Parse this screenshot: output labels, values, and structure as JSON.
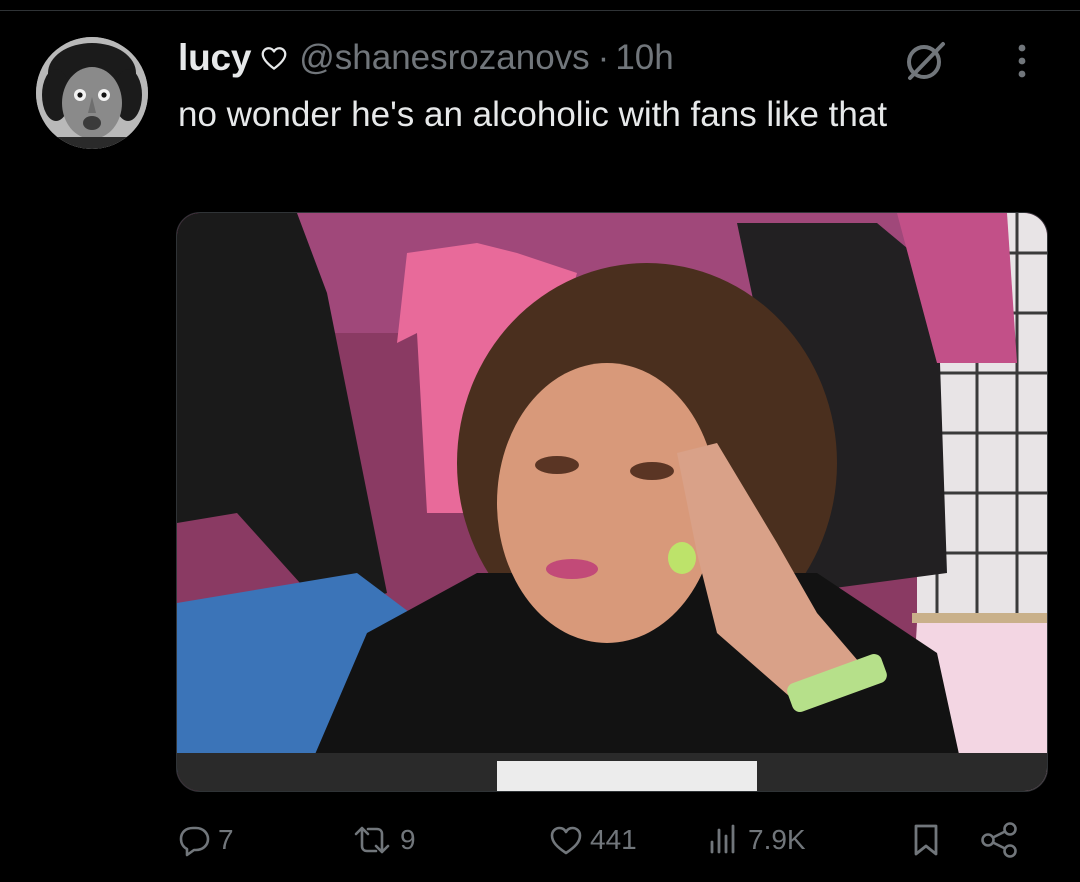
{
  "post": {
    "display_name": "lucy",
    "handle": "@shanesrozanovs",
    "separator": "·",
    "timestamp": "10h",
    "text": "no wonder he's an alcoholic with fans like that"
  },
  "icons": {
    "name_badge": "heart-outline-icon",
    "grok": "grok-icon",
    "more": "more-vertical-icon",
    "reply": "reply-icon",
    "retweet": "retweet-icon",
    "like": "heart-icon",
    "views": "views-bar-chart-icon",
    "bookmark": "bookmark-icon",
    "share": "share-icon"
  },
  "actions": {
    "reply_count": "7",
    "retweet_count": "9",
    "like_count": "441",
    "views_count": "7.9K"
  },
  "colors": {
    "background": "#000000",
    "primary_text": "#e7e9ea",
    "secondary_text": "#71767b",
    "divider": "#2f3336"
  }
}
